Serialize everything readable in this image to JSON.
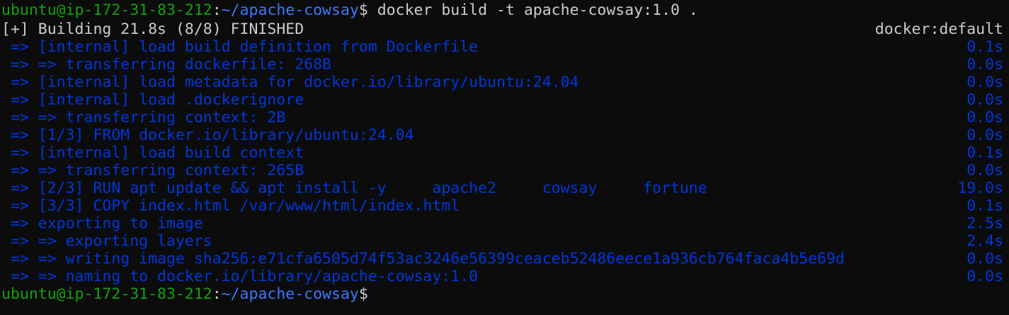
{
  "prompt": {
    "user_host": "ubuntu@ip-172-31-83-212",
    "colon": ":",
    "path": "~/apache-cowsay",
    "dollar": "$"
  },
  "command": " docker build -t apache-cowsay:1.0 .",
  "header": {
    "status": "[+] Building 21.8s (8/8) FINISHED",
    "builder": "docker:default"
  },
  "steps": [
    {
      "text": " => [internal] load build definition from Dockerfile",
      "time": "0.1s"
    },
    {
      "text": " => => transferring dockerfile: 268B",
      "time": "0.0s"
    },
    {
      "text": " => [internal] load metadata for docker.io/library/ubuntu:24.04",
      "time": "0.0s"
    },
    {
      "text": " => [internal] load .dockerignore",
      "time": "0.0s"
    },
    {
      "text": " => => transferring context: 2B",
      "time": "0.0s"
    },
    {
      "text": " => [1/3] FROM docker.io/library/ubuntu:24.04",
      "time": "0.0s"
    },
    {
      "text": " => [internal] load build context",
      "time": "0.1s"
    },
    {
      "text": " => => transferring context: 265B",
      "time": "0.0s"
    },
    {
      "text": " => [2/3] RUN apt update && apt install -y     apache2     cowsay     fortune",
      "time": "19.0s"
    },
    {
      "text": " => [3/3] COPY index.html /var/www/html/index.html",
      "time": "0.1s"
    },
    {
      "text": " => exporting to image",
      "time": "2.5s"
    },
    {
      "text": " => => exporting layers",
      "time": "2.4s"
    },
    {
      "text": " => => writing image sha256:e71cfa6505d74f53ac3246e56399ceaceb52486eece1a936cb764faca4b5e69d",
      "time": "0.0s"
    },
    {
      "text": " => => naming to docker.io/library/apache-cowsay:1.0",
      "time": "0.0s"
    }
  ]
}
